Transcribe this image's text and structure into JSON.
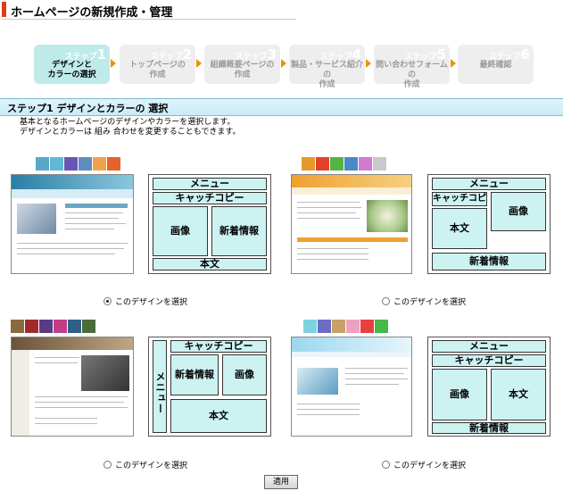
{
  "header": {
    "title": "ホームページの新規作成・管理"
  },
  "steps": [
    {
      "num": "1",
      "prefix": "ステップ",
      "label_line1": "デザインと",
      "label_line2": "カラーの選択",
      "active": true
    },
    {
      "num": "2",
      "prefix": "ステップ",
      "label_line1": "トップページの",
      "label_line2": "作成",
      "active": false
    },
    {
      "num": "3",
      "prefix": "ステップ",
      "label_line1": "組織概要ページの",
      "label_line2": "作成",
      "active": false
    },
    {
      "num": "4",
      "prefix": "ステップ",
      "label_line1": "製品・サービス紹介の",
      "label_line2": "作成",
      "active": false
    },
    {
      "num": "5",
      "prefix": "ステップ",
      "label_line1": "問い合わせフォームの",
      "label_line2": "作成",
      "active": false
    },
    {
      "num": "6",
      "prefix": "ステップ",
      "label_line1": "最終確認",
      "label_line2": "",
      "active": false
    }
  ],
  "section": {
    "title": "ステップ1 デザインとカラーの 選択"
  },
  "description": {
    "line1": "基本となるホームページのデザインやカラーを選択します。",
    "line2": "デザインとカラーは 組み 合わせを変更することもできます。"
  },
  "designs": [
    {
      "swatches": [
        "#5aa7c8",
        "#5fb8d6",
        "#6a55b5",
        "#5f8dc0",
        "#f0a34a",
        "#e6622a"
      ],
      "preview_header_color": "#2f8ab0",
      "layout_cells": {
        "menu": "メニュー",
        "catch": "キャッチコピー",
        "image": "画像",
        "news": "新着情報",
        "body": "本文"
      },
      "radio_label": "このデザインを選択",
      "selected": true
    },
    {
      "swatches": [
        "#e39a2a",
        "#e4402a",
        "#55b343",
        "#4c88c6",
        "#d07bd0",
        "#c9c9c9"
      ],
      "preview_header_color": "#f0a030",
      "layout_cells": {
        "menu": "メニュー",
        "catch": "キャッチコピー",
        "image": "画像",
        "news": "新着情報",
        "body": "本文"
      },
      "radio_label": "このデザインを選択",
      "selected": false
    },
    {
      "swatches": [
        "#8a6b3d",
        "#a02a2a",
        "#5a3a86",
        "#c23d86",
        "#2e5f8a",
        "#4c6b3a"
      ],
      "preview_header_color": "#6a5338",
      "layout_cells": {
        "menu": "メニュー",
        "catch": "キャッチコピー",
        "image": "画像",
        "news": "新着情報",
        "body": "本文"
      },
      "radio_label": "このデザインを選択",
      "selected": false
    },
    {
      "swatches": [
        "#7fd3e0",
        "#6c6cc8",
        "#c8a06a",
        "#f0a0c0",
        "#e84040",
        "#45b84a"
      ],
      "preview_header_color": "#9ad8ee",
      "layout_cells": {
        "menu": "メニュー",
        "catch": "キャッチコピー",
        "image": "画像",
        "news": "新着情報",
        "body": "本文"
      },
      "radio_label": "このデザインを選択",
      "selected": false
    }
  ],
  "apply_button": {
    "label": "適用"
  }
}
